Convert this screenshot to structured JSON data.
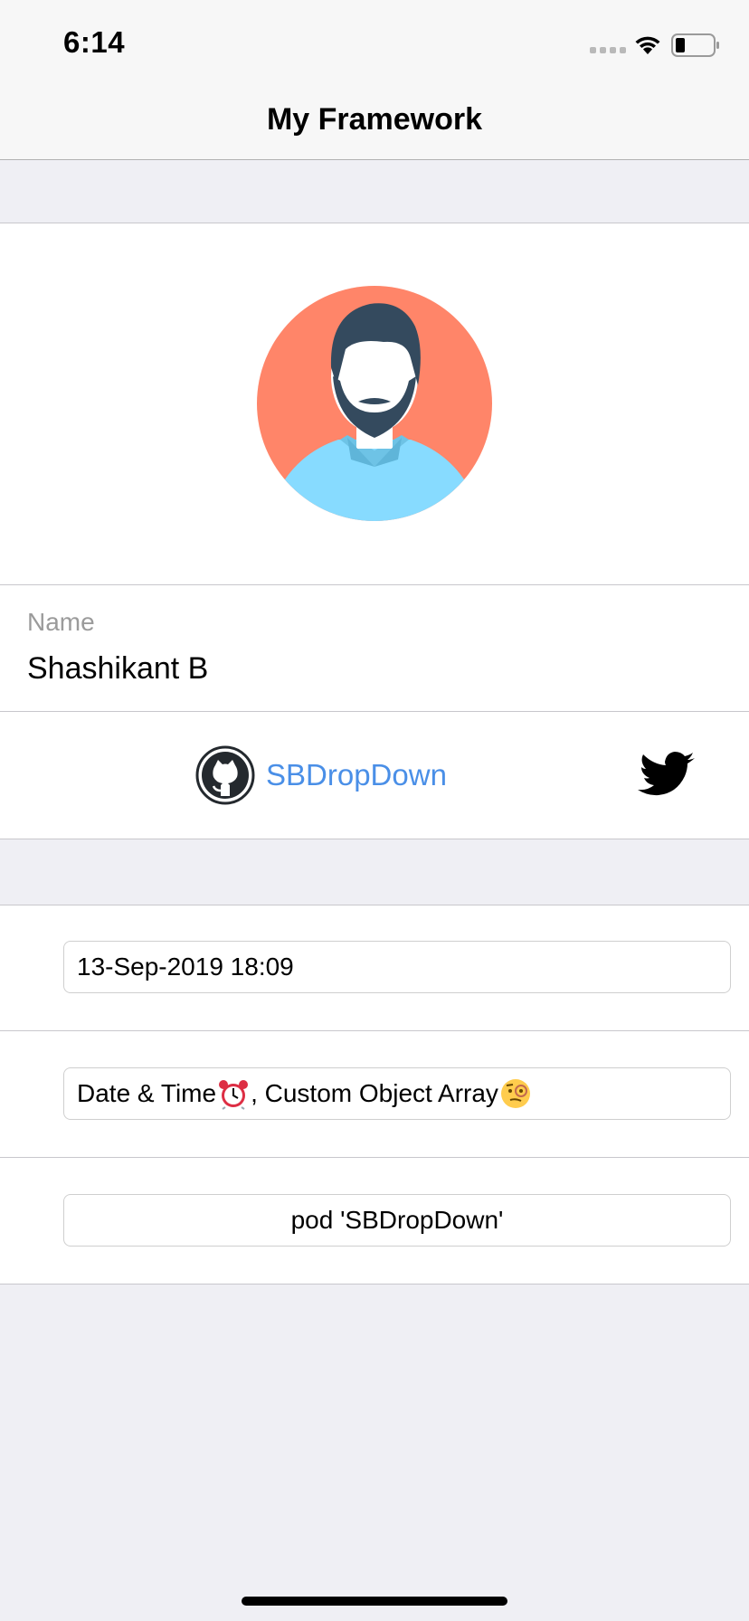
{
  "status_bar": {
    "time": "6:14"
  },
  "nav": {
    "title": "My Framework"
  },
  "profile": {
    "avatar_icon": "user-avatar-icon"
  },
  "name_row": {
    "label": "Name",
    "value": "Shashikant B"
  },
  "links": {
    "github_label": "SBDropDown",
    "github_icon": "github-icon",
    "twitter_icon": "twitter-icon"
  },
  "fields": {
    "date_value": "13-Sep-2019 18:09",
    "types_text": "Date & Time",
    "types_text_2": ", Custom Object Array",
    "pod_value": "pod 'SBDropDown'"
  },
  "colors": {
    "link": "#4a8fe7",
    "avatar_bg": "#ff8569",
    "shirt": "#87dbff",
    "hair": "#344a5e"
  }
}
